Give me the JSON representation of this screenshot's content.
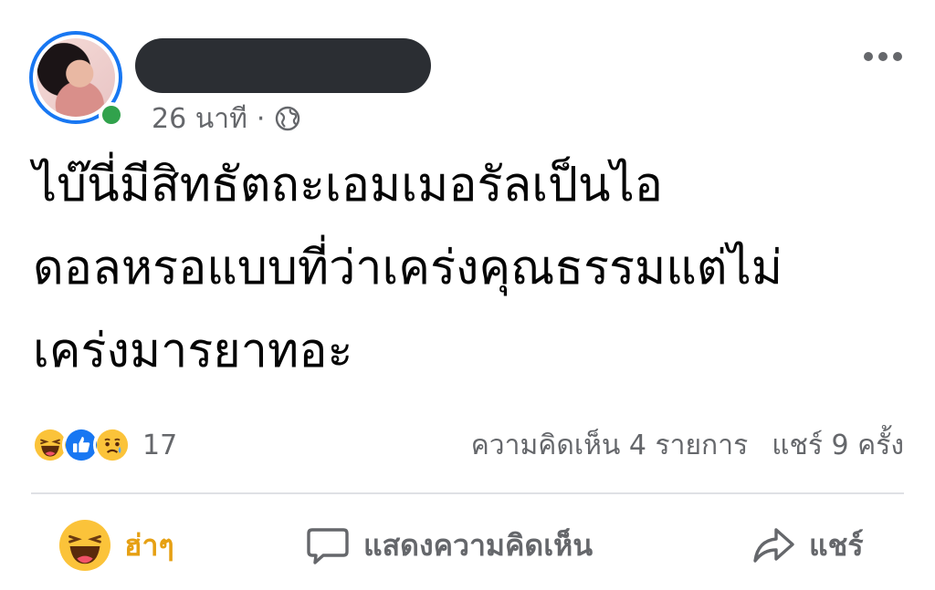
{
  "post": {
    "time": "26 นาที",
    "separator": "·",
    "privacy_icon": "globe-icon",
    "text": "ไบ๊นี่มีสิทธัตถะเอมเมอรัลเป็นไอ\nดอลหรอแบบที่ว่าเคร่งคุณธรรมแต่ไม่\nเคร่งมารยาทอะ"
  },
  "reactions": {
    "icons": [
      "haha-icon",
      "like-icon",
      "sad-icon"
    ],
    "count": "17"
  },
  "stats": {
    "comments": "ความคิดเห็น 4 รายการ",
    "shares": "แชร์ 9 ครั้ง"
  },
  "actions": {
    "reaction_label": "ฮ่าๆ",
    "comment_label": "แสดงความคิดเห็น",
    "share_label": "แชร์"
  },
  "colors": {
    "accent_blue": "#1877f2",
    "online_green": "#31a24c",
    "haha_yellow": "#e6a013",
    "secondary_text": "#65676b"
  }
}
